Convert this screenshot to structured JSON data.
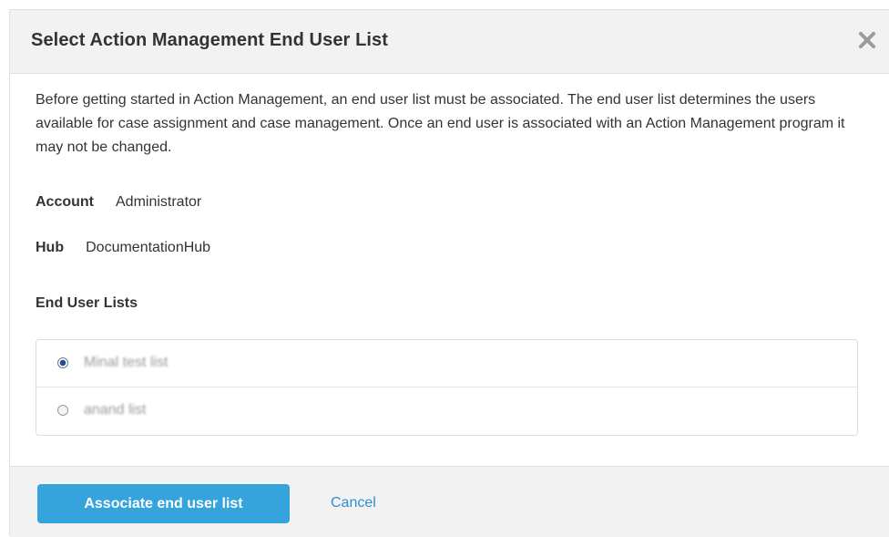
{
  "dialog": {
    "title": "Select Action Management End User List",
    "close_icon": "close-icon"
  },
  "body": {
    "intro": "Before getting started in Action Management, an end user list must be associated. The end user list determines the users available for case assignment and case management. Once an end user is associated with an Action Management program it may not be changed.",
    "account": {
      "label": "Account",
      "value": "Administrator"
    },
    "hub": {
      "label": "Hub",
      "value": "DocumentationHub"
    },
    "lists_heading": "End User Lists",
    "lists": [
      {
        "label": "Minal test list",
        "selected": true
      },
      {
        "label": "anand list",
        "selected": false
      }
    ]
  },
  "footer": {
    "primary_label": "Associate end user list",
    "cancel_label": "Cancel"
  },
  "colors": {
    "primary": "#35a3dc",
    "link": "#2f8ecf",
    "header_bg": "#f2f2f2"
  }
}
